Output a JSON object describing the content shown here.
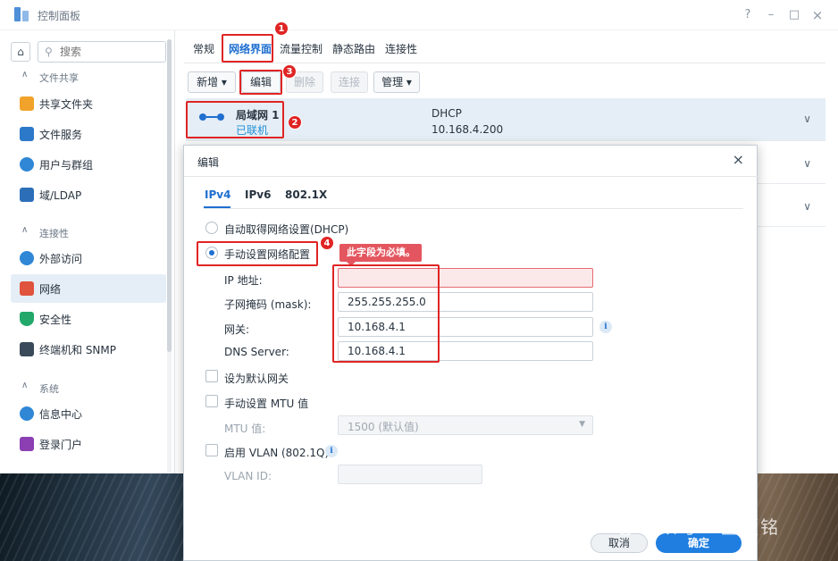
{
  "window": {
    "title": "控制面板",
    "controls": [
      "?",
      "–",
      "□",
      "×"
    ]
  },
  "sidebar": {
    "search_placeholder": "搜索",
    "sections": [
      {
        "label": "文件共享",
        "items": [
          {
            "label": "共享文件夹",
            "icon": "folder-icon",
            "color": "#f0a22b"
          },
          {
            "label": "文件服务",
            "icon": "file-services-icon",
            "color": "#2c78c9"
          },
          {
            "label": "用户与群组",
            "icon": "users-icon",
            "color": "#2f87d6"
          },
          {
            "label": "域/LDAP",
            "icon": "domain-icon",
            "color": "#2c6fb8"
          }
        ]
      },
      {
        "label": "连接性",
        "items": [
          {
            "label": "外部访问",
            "icon": "external-access-icon",
            "color": "#2f87d6"
          },
          {
            "label": "网络",
            "icon": "network-house-icon",
            "color": "#e0533d",
            "active": true
          },
          {
            "label": "安全性",
            "icon": "shield-icon",
            "color": "#21a86a"
          },
          {
            "label": "终端机和 SNMP",
            "icon": "terminal-icon",
            "color": "#3b4a5a"
          }
        ]
      },
      {
        "label": "系统",
        "items": [
          {
            "label": "信息中心",
            "icon": "info-icon",
            "color": "#2f87d6"
          },
          {
            "label": "登录门户",
            "icon": "login-portal-icon",
            "color": "#8b3fb3"
          }
        ]
      }
    ]
  },
  "tabs": [
    "常规",
    "网络界面",
    "流量控制",
    "静态路由",
    "连接性"
  ],
  "toolbar": {
    "create": "新增 ▾",
    "edit": "编辑",
    "delete": "删除",
    "connect": "连接",
    "manage": "管理 ▾"
  },
  "interfaces": [
    {
      "name": "局域网 1",
      "status": "已联机",
      "mode": "DHCP",
      "ip": "10.168.4.200"
    }
  ],
  "dialog": {
    "title": "编辑",
    "tabs": [
      "IPv4",
      "IPv6",
      "802.1X"
    ],
    "auto_label": "自动取得网络设置(DHCP)",
    "manual_label": "手动设置网络配置",
    "tooltip": "此字段为必填。",
    "ip_label": "IP 地址:",
    "ip_value": "",
    "mask_label": "子网掩码 (mask):",
    "mask_value": "255.255.255.0",
    "gateway_label": "网关:",
    "gateway_value": "10.168.4.1",
    "dns_label": "DNS Server:",
    "dns_value": "10.168.4.1",
    "default_gw_label": "设为默认网关",
    "mtu_manual_label": "手动设置 MTU 值",
    "mtu_label": "MTU 值:",
    "mtu_value": "1500 (默认值)",
    "vlan_label": "启用 VLAN (802.1Q)",
    "vlan_id_label": "VLAN ID:",
    "cancel": "取消",
    "ok": "确定"
  },
  "annotations": [
    "1",
    "2",
    "3",
    "4"
  ],
  "watermark": "公众号 · 尘覆铭"
}
